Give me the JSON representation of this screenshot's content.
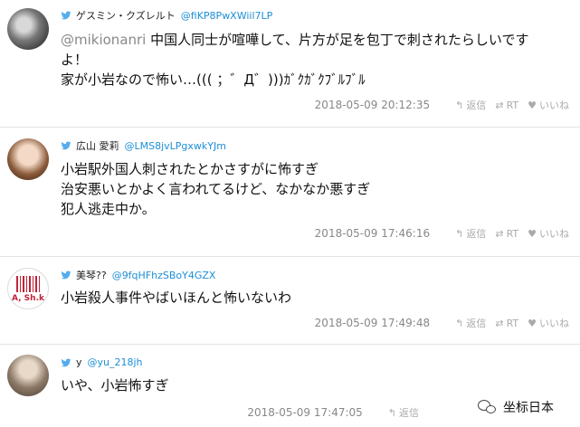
{
  "tweets": [
    {
      "name": "ゲスミン・クズレルト",
      "handle": "@fiKP8PwXWiil7LP",
      "mention": "@mikionanri",
      "line1": " 中国人同士が喧嘩して、片方が足を包丁で刺されたらしいです",
      "line2": "よ！",
      "line3": "家が小岩なので怖い…((( ；゛Д゛)))ｶﾞｸｶﾞｸﾌﾞﾙﾌﾞﾙ",
      "timestamp": "2018-05-09 20:12:35"
    },
    {
      "name": "広山 愛莉",
      "handle": "@LMS8jvLPgxwkYJm",
      "line1": "小岩駅外国人刺されたとかさすがに怖すぎ",
      "line2": "治安悪いとかよく言われてるけど、なかなか悪すぎ",
      "line3": "犯人逃走中か。",
      "timestamp": "2018-05-09 17:46:16"
    },
    {
      "name": "美琴??",
      "handle": "@9fqHFhzSBoY4GZX",
      "line1": "小岩殺人事件やばいほんと怖いないわ",
      "avatar_text": "A, Sh.k",
      "timestamp": "2018-05-09 17:49:48"
    },
    {
      "name": "y",
      "handle": "@yu_218jh",
      "line1": "いや、小岩怖すぎ",
      "timestamp": "2018-05-09 17:47:05"
    }
  ],
  "actions": {
    "reply": "返信",
    "retweet": "RT",
    "like": "いいね"
  },
  "icons": {
    "bird": "twitter-bird-icon",
    "reply": "reply-arrow-icon",
    "retweet": "retweet-icon",
    "like": "heart-icon"
  },
  "colors": {
    "handle": "#1d8fd6",
    "bird": "#55acee",
    "meta": "#999999"
  },
  "watermark": {
    "text": "坐标日本"
  }
}
